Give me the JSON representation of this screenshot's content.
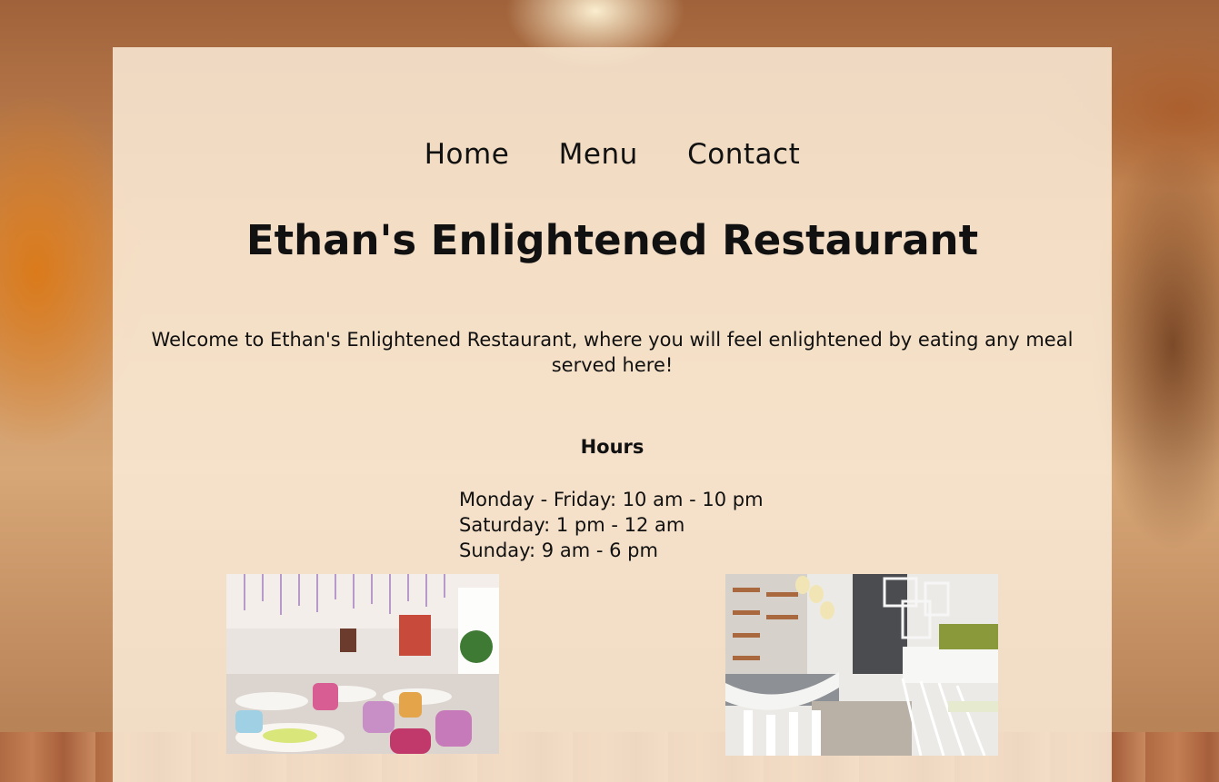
{
  "nav": {
    "items": [
      {
        "label": "Home"
      },
      {
        "label": "Menu"
      },
      {
        "label": "Contact"
      }
    ]
  },
  "header": {
    "title": "Ethan's Enlightened Restaurant"
  },
  "main": {
    "welcome": "Welcome to Ethan's Enlightened Restaurant, where you will feel enlightened by eating any meal served here!",
    "hours": {
      "heading": "Hours",
      "lines": [
        "Monday - Friday: 10 am - 10 pm",
        "Saturday: 1 pm - 12 am",
        "Sunday: 9 am - 6 pm"
      ]
    }
  },
  "colors": {
    "panel": "#faebd7",
    "text": "#111111"
  }
}
